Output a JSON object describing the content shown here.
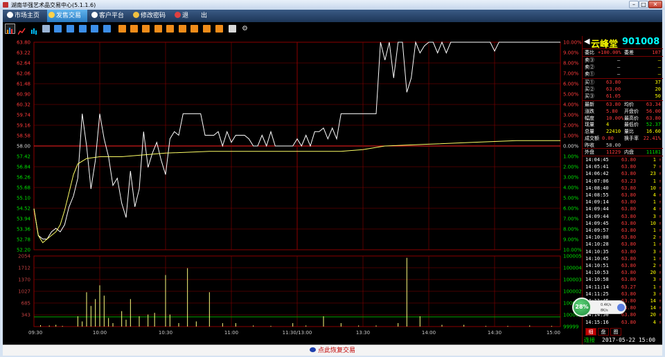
{
  "window": {
    "title": "湖南华强艺术品交易中心(5.1.1.6)",
    "min_icon": "minimize-icon",
    "max_icon": "maximize-icon",
    "close_icon": "close-icon"
  },
  "menu": {
    "items": [
      {
        "label": "市场主页",
        "icon": "globe-icon",
        "active": false
      },
      {
        "label": "发售交易",
        "icon": "trade-icon",
        "active": true
      },
      {
        "label": "客户平台",
        "icon": "globe-icon",
        "active": false
      },
      {
        "label": "修改密码",
        "icon": "key-icon",
        "active": false
      },
      {
        "label": "退",
        "icon": "power-icon",
        "active": false
      },
      {
        "label": "出",
        "icon": "",
        "active": false
      }
    ]
  },
  "toolbar": {
    "icons": [
      "bar-chart-icon",
      "line-chart-icon",
      "candle-icon",
      "calendar-icon",
      "grid-icon",
      "n-icon",
      "m-icon",
      "z-icon",
      "x-icon",
      "tool1-icon",
      "tool2-icon",
      "tool3-icon",
      "tool4-icon",
      "tool5-icon",
      "tool6-icon",
      "tool7-icon",
      "tool8-icon",
      "tool9-icon",
      "pen-icon",
      "gear-icon"
    ]
  },
  "chart_data": {
    "type": "line",
    "title": "",
    "price_axis": {
      "left_ticks": [
        "63.80",
        "63.22",
        "62.64",
        "62.06",
        "61.48",
        "60.90",
        "60.32",
        "59.74",
        "59.16",
        "58.58",
        "58.00",
        "57.42",
        "56.84",
        "56.26",
        "55.68",
        "55.10",
        "54.52",
        "53.94",
        "53.36",
        "52.78",
        "52.20"
      ],
      "right_ticks": [
        "10.00%",
        "9.00%",
        "8.00%",
        "7.00%",
        "6.00%",
        "5.00%",
        "4.00%",
        "3.00%",
        "2.00%",
        "1.00%",
        "0.00%",
        "1.00%",
        "2.00%",
        "3.00%",
        "4.00%",
        "5.00%",
        "6.00%",
        "7.00%",
        "8.00%",
        "9.00%",
        "10.00%"
      ],
      "ylim": [
        52.2,
        63.8
      ],
      "prev_close": 58.0
    },
    "volume_axis": {
      "left_ticks": [
        "2054",
        "1712",
        "1370",
        "1027",
        "685",
        "343"
      ],
      "right_ticks": [
        "100005",
        "100004",
        "100003",
        "100002",
        "100001",
        "100000",
        "99999"
      ],
      "ylim": [
        0,
        2054
      ]
    },
    "time_labels": [
      "09:30",
      "10:00",
      "10:30",
      "11:00",
      "11:30/13:00",
      "13:30",
      "14:00",
      "14:30",
      "15:00"
    ],
    "series": [
      {
        "color": "#ffffff",
        "x": [
          0,
          2,
          4,
          6,
          8,
          10,
          12,
          14,
          16,
          18,
          20,
          22,
          24,
          26,
          28,
          30,
          32,
          34,
          36,
          38,
          40,
          42,
          44,
          46,
          48,
          50,
          52,
          54,
          56,
          58,
          60,
          62,
          64,
          66,
          68,
          70,
          72,
          74,
          76,
          78,
          80,
          82,
          84,
          86,
          88,
          90,
          92,
          94,
          96,
          98,
          100,
          102,
          104,
          106,
          108,
          110,
          112,
          114,
          116,
          118,
          120,
          122,
          124,
          126,
          128,
          130,
          132,
          134,
          136,
          138,
          140,
          142,
          144,
          146,
          148,
          150,
          152,
          154,
          156,
          158,
          160,
          162,
          164,
          166,
          168,
          170,
          172,
          174,
          176,
          178,
          180,
          182,
          184,
          186,
          188,
          190,
          192,
          194,
          196,
          198,
          200,
          202,
          204,
          206,
          208,
          210,
          212,
          214,
          216,
          218,
          220,
          222,
          224,
          226,
          228,
          230,
          232,
          234,
          236,
          238,
          240
        ],
        "values": [
          54.5,
          53.0,
          52.8,
          52.8,
          53.2,
          53.4,
          53.2,
          53.6,
          54.6,
          55.2,
          56.2,
          59.8,
          58.0,
          55.6,
          57.2,
          59.8,
          58.4,
          57.4,
          55.8,
          56.2,
          54.8,
          54.0,
          56.6,
          54.6,
          55.6,
          58.8,
          56.8,
          57.6,
          58.2,
          57.2,
          56.4,
          58.4,
          58.8,
          58.6,
          59.8,
          59.8,
          59.8,
          59.8,
          59.8,
          58.6,
          58.6,
          58.6,
          58.8,
          58.0,
          58.8,
          58.2,
          58.6,
          58.6,
          58.6,
          58.4,
          58.0,
          58.0,
          58.6,
          58.0,
          58.8,
          58.0,
          58.0,
          58.0,
          58.0,
          58.0,
          58.4,
          58.0,
          58.6,
          58.0,
          58.8,
          58.8,
          59.0,
          58.4,
          59.0,
          58.4,
          59.8,
          59.8,
          59.8,
          59.8,
          59.8,
          59.8,
          59.8,
          59.8,
          59.8,
          63.8,
          62.8,
          63.8,
          61.8,
          63.8,
          63.8,
          61.0,
          61.8,
          63.8,
          63.2,
          63.6,
          63.8,
          63.8,
          63.2,
          63.8,
          63.2,
          63.8,
          63.8,
          63.8,
          63.8,
          63.8,
          63.8,
          63.8,
          63.8,
          63.8,
          63.8,
          63.3,
          63.8,
          63.8,
          63.8,
          63.8,
          63.8,
          63.8,
          63.8,
          63.8,
          63.8,
          63.8,
          63.8,
          63.8,
          63.8,
          63.8,
          63.8
        ]
      },
      {
        "color": "#ffff66",
        "x": [
          0,
          2,
          4,
          6,
          8,
          10,
          12,
          14,
          16,
          18,
          20,
          24,
          30,
          40,
          60,
          80,
          100,
          120,
          140,
          150,
          160,
          180,
          200,
          220,
          240
        ],
        "values": [
          54.5,
          53.0,
          52.6,
          52.8,
          53.0,
          53.2,
          53.6,
          54.4,
          55.4,
          56.4,
          57.0,
          57.3,
          57.4,
          57.4,
          57.6,
          57.7,
          57.7,
          57.7,
          57.7,
          57.8,
          58.0,
          58.1,
          58.2,
          58.3,
          58.3
        ]
      }
    ],
    "volumes": {
      "x": [
        3,
        7,
        10,
        13,
        20,
        22,
        24,
        26,
        28,
        30,
        32,
        34,
        36,
        40,
        42,
        44,
        48,
        52,
        55,
        60,
        62,
        66,
        70,
        74,
        80,
        86,
        92,
        100,
        108,
        118,
        124,
        132,
        140,
        148,
        156,
        166,
        170,
        176,
        186,
        196,
        206,
        216,
        226,
        236
      ],
      "values": [
        40,
        30,
        50,
        20,
        300,
        150,
        1000,
        600,
        800,
        1200,
        900,
        250,
        100,
        450,
        200,
        800,
        300,
        350,
        400,
        1500,
        350,
        100,
        1700,
        150,
        1000,
        100,
        100,
        30,
        20,
        100,
        30,
        300,
        100,
        30,
        30,
        100,
        2000,
        300,
        50,
        50,
        20,
        20,
        30,
        20
      ]
    }
  },
  "quote": {
    "name": "云峰堂",
    "code": "901008",
    "weibi_label": "委比",
    "weibi_value": "+100.00%",
    "weicha_label": "委差",
    "weicha_value": "107",
    "asks": [
      {
        "label": "卖③",
        "price": "—",
        "qty": "—"
      },
      {
        "label": "卖②",
        "price": "—",
        "qty": "—"
      },
      {
        "label": "卖①",
        "price": "—",
        "qty": "—"
      }
    ],
    "bids": [
      {
        "label": "买①",
        "price": "63.80",
        "qty": "37"
      },
      {
        "label": "买②",
        "price": "63.00",
        "qty": "20"
      },
      {
        "label": "买③",
        "price": "61.05",
        "qty": "50"
      }
    ],
    "stats": [
      {
        "l1": "最新",
        "v1": "63.80",
        "l2": "均价",
        "v2": "63.34"
      },
      {
        "l1": "涨跌",
        "v1": "5.80",
        "l2": "开盘价",
        "v2": "56.00"
      },
      {
        "l1": "幅度",
        "v1": "10.00%",
        "l2": "最高价",
        "v2": "63.80"
      },
      {
        "l1": "现量",
        "v1": "4",
        "l2": "最低价",
        "v2": "52.37"
      },
      {
        "l1": "总量",
        "v1": "22410",
        "l2": "量比",
        "v2": "16.60"
      },
      {
        "l1": "成交额",
        "v1": "0.00",
        "l2": "换手率",
        "v2": "22.41%"
      },
      {
        "l1": "昨收",
        "v1": "58.00",
        "l2": "",
        "v2": ""
      }
    ],
    "outer_label": "外盘",
    "outer_value": "11229",
    "inner_label": "内盘",
    "inner_value": "11181"
  },
  "ticks": [
    {
      "t": "14:04:45",
      "p": "63.80",
      "q": "1"
    },
    {
      "t": "14:05:41",
      "p": "63.80",
      "q": "7"
    },
    {
      "t": "14:06:42",
      "p": "63.80",
      "q": "23"
    },
    {
      "t": "14:07:06",
      "p": "63.23",
      "q": "1"
    },
    {
      "t": "14:08:40",
      "p": "63.80",
      "q": "10"
    },
    {
      "t": "14:08:55",
      "p": "63.80",
      "q": "4"
    },
    {
      "t": "14:09:14",
      "p": "63.80",
      "q": "1"
    },
    {
      "t": "14:09:44",
      "p": "63.80",
      "q": "4"
    },
    {
      "t": "14:09:44",
      "p": "63.80",
      "q": "3"
    },
    {
      "t": "14:09:45",
      "p": "63.80",
      "q": "10"
    },
    {
      "t": "14:09:57",
      "p": "63.80",
      "q": "1"
    },
    {
      "t": "14:10:08",
      "p": "63.80",
      "q": "2"
    },
    {
      "t": "14:10:28",
      "p": "63.80",
      "q": "1"
    },
    {
      "t": "14:10:35",
      "p": "63.80",
      "q": "3"
    },
    {
      "t": "14:10:45",
      "p": "63.80",
      "q": "1"
    },
    {
      "t": "14:10:51",
      "p": "63.80",
      "q": "2"
    },
    {
      "t": "14:10:53",
      "p": "63.80",
      "q": "20"
    },
    {
      "t": "14:10:58",
      "p": "63.80",
      "q": "3"
    },
    {
      "t": "14:11:14",
      "p": "63.27",
      "q": "1"
    },
    {
      "t": "14:11:25",
      "p": "63.80",
      "q": "3"
    },
    {
      "t": "14:11:45",
      "p": "63.80",
      "q": "14"
    },
    {
      "t": "14:14:40",
      "p": "63.80",
      "q": "14"
    },
    {
      "t": "14:14:50",
      "p": "63.80",
      "q": "20"
    },
    {
      "t": "14:15:16",
      "p": "63.80",
      "q": "4"
    }
  ],
  "tabs": [
    "细",
    "盘",
    "图"
  ],
  "status": {
    "connection": "连接",
    "datetime": "2017-05-22 15:00"
  },
  "speed_widget": {
    "percent": "28%",
    "up": "0.4K/s",
    "down": "8K/s"
  },
  "restore_bar": {
    "label": "点此恢复交易"
  },
  "colors": {
    "up": "#ff3b3b",
    "down": "#00e000",
    "grid": "#8b0000",
    "axis_text": "#c04040",
    "price_line": "#ffffff",
    "avg_line": "#ffff66",
    "volume": "#ffff80"
  }
}
